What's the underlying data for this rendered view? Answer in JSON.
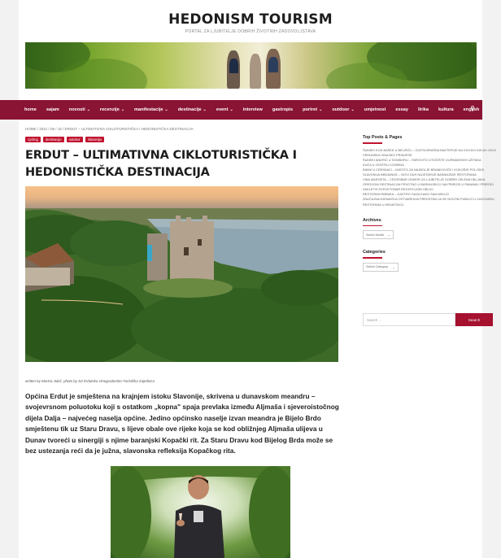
{
  "site": {
    "title": "HEDONISM TOURISM",
    "tagline": "PORTAL ZA LJUBITELJE DOBRIH ŽIVOTNIH ZADOVOLJSTAVA"
  },
  "nav": {
    "items": [
      {
        "label": "home",
        "dropdown": false
      },
      {
        "label": "sajam",
        "dropdown": false
      },
      {
        "label": "novosti",
        "dropdown": true
      },
      {
        "label": "recenzije",
        "dropdown": true
      },
      {
        "label": "manifestacije",
        "dropdown": true
      },
      {
        "label": "destinacije",
        "dropdown": true
      },
      {
        "label": "event",
        "dropdown": true
      },
      {
        "label": "interview",
        "dropdown": false
      },
      {
        "label": "gastropis",
        "dropdown": false
      },
      {
        "label": "portret",
        "dropdown": true
      },
      {
        "label": "outdoor",
        "dropdown": true
      },
      {
        "label": "umjetnost",
        "dropdown": false
      },
      {
        "label": "essay",
        "dropdown": false
      },
      {
        "label": "lirika",
        "dropdown": false
      },
      {
        "label": "kultura",
        "dropdown": false
      },
      {
        "label": "english",
        "dropdown": false
      }
    ],
    "search_icon": "search-icon"
  },
  "post": {
    "breadcrumb": "HOME / 2021 / 09 / 15 / ERDUT – ULTIMATIVNA CIKLOTURISTIČKA I HEDONISTIČKA DESTINACIJA",
    "categories": [
      "cycling",
      "destinacije",
      "outdoor",
      "Slavonija"
    ],
    "title": "ERDUT – ULTIMATIVNA CIKLOTURISTIČKA I HEDONISTIČKA DESTINACIJA",
    "credit": "written by Marina Jukić, photo by SZ Erdutska Vinogradarsko-Turistička Zajednica",
    "intro": "Općina Erdut je smještena na krajnjem istoku Slavonije, skrivena u dunavskom meandru – svojevrsnom poluotoku koji s ostatkom „kopna\" spaja prevlaka između Aljmaša i sjeveroistočnog dijela Dalja – najvećeg naselja općine. Jedino općinsko naselje izvan meandra je Bijelo Brdo smještenu tik uz Staru Dravu, s lijeve obale ove rijeke koja se kod obližnjeg Aljmaša ulijeva u Dunav tvoreći u sinergiji s njime baranjski Kopački rit.  Za Staru Dravu kod Bijelog Brda može se bez ustezanja reći da je južna, slavonska refleksija Kopačkog rita."
  },
  "sidebar": {
    "top_posts_title": "Top Posts & Pages",
    "top_posts": [
      "ŠUMSKI KOD BAŠKE U BELIŠĆU – GUSTA BRAŠNA BAKTERIJE NA DVOJICI IDEJA I OKUSA",
      "VRHUNSKA VINA BEZ PRIMJESE",
      "ŠUMSKI ANDRIĆ U SOMBORU – SKROVITO UTOČIŠTE GURMANSKIH UŽITAKA",
      "KUĆA U CENTRU CODRINA",
      "BIKINI U CRESINICI – MJESTO ZA NAJBOLJE BRANKOVIĆE I KOKOŠJE POLJSKE",
      "SLAVONIJA IMBIJANIJE – NOVI DUH NAJSTARIJE BARANJSKE RESTORANA",
      "VINA MARIJETA – CROSSBAR ODMOR ZA LJUBITELJE DOBRIH ZELENIH BILJAKA",
      "ORESJONI DESTINACIJA PRVOTNO U BARANJSKOJ NA PRIRODI U PANAMA I PRIRODI",
      "ZAKLETVI EXPOKTOBAR RECEPCIJOM OBLICI",
      "RESTORAN RIBNIKA – GASTRO OAZA KAKO SAM MISLIO",
      "ZNAČAJNA NJEMAČKA OSTVARENJA PREDSTAVLJA SE NOVOM PUBLICI U VUKOVARU",
      "RESTORANI U HRVATSKOJ"
    ],
    "archives_title": "Archives",
    "archives_select": "Select Month",
    "categories_title": "Categories",
    "categories_select": "Select Category",
    "search_placeholder": "Search ...",
    "search_button": "Search"
  },
  "colors": {
    "nav_bg": "#8a1434",
    "accent": "#c0142f",
    "search_button": "#a5112f"
  }
}
